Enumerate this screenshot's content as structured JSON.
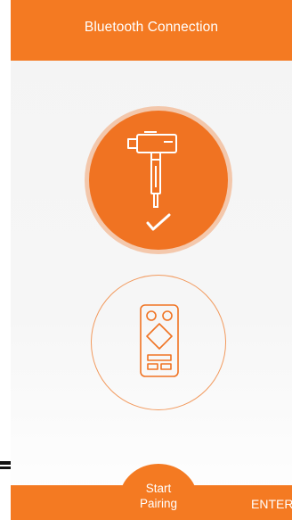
{
  "header": {
    "title": "Bluetooth Connection"
  },
  "devices": [
    {
      "name_icon": "gimbal-stick-icon",
      "selected": true,
      "check_icon": "checkmark-icon"
    },
    {
      "name_icon": "remote-control-icon",
      "selected": false
    }
  ],
  "footer": {
    "start_pairing_line1": "Start",
    "start_pairing_line2": "Pairing",
    "enter_label": "ENTER"
  },
  "colors": {
    "accent": "#f47a22",
    "accent_light": "#f29a5e",
    "background": "#f4f4f4",
    "text_on_accent": "#ffffff"
  }
}
